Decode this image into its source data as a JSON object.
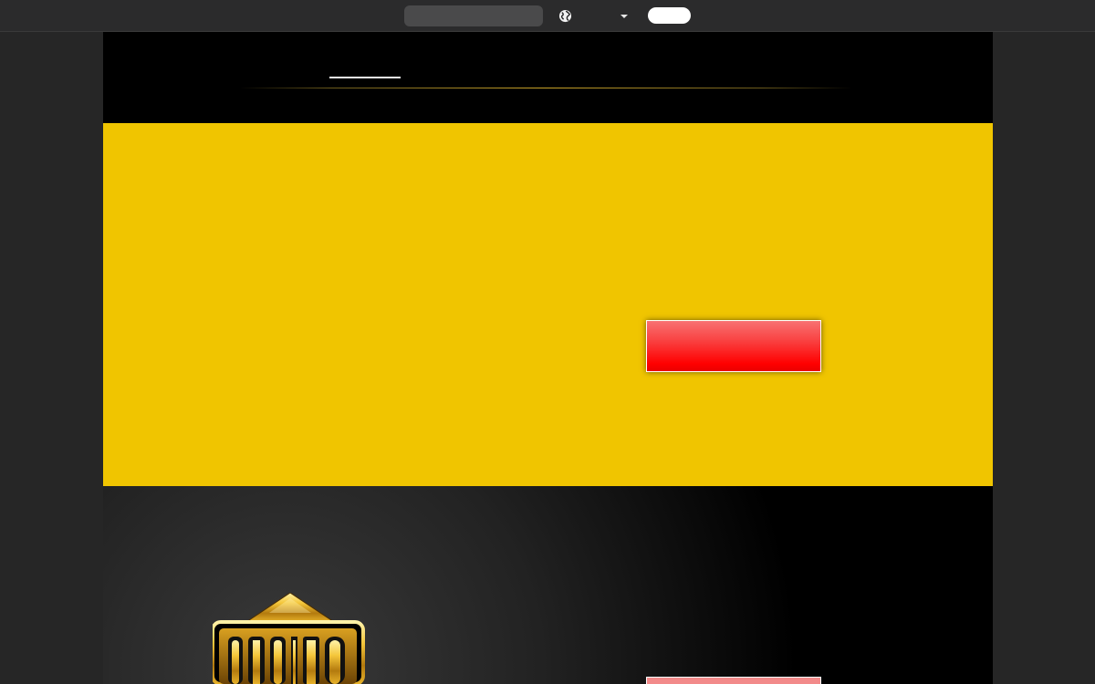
{
  "browser": {
    "search": {
      "placeholder": ""
    },
    "language_icon": "globe-icon",
    "dropdown_icon": "caret-down-icon",
    "account_button_label": ""
  },
  "colors": {
    "topbar": "#2b2b2c",
    "page_background": "#262626",
    "content_background": "#000000",
    "hero_background": "#f0c500",
    "cta_red": "#ff0000",
    "accent_gold": "#c9a227"
  },
  "header": {
    "nav_active_label": ""
  },
  "hero": {
    "cta_label": ""
  },
  "section": {
    "logo_text": "CASINO",
    "cta_label": ""
  }
}
